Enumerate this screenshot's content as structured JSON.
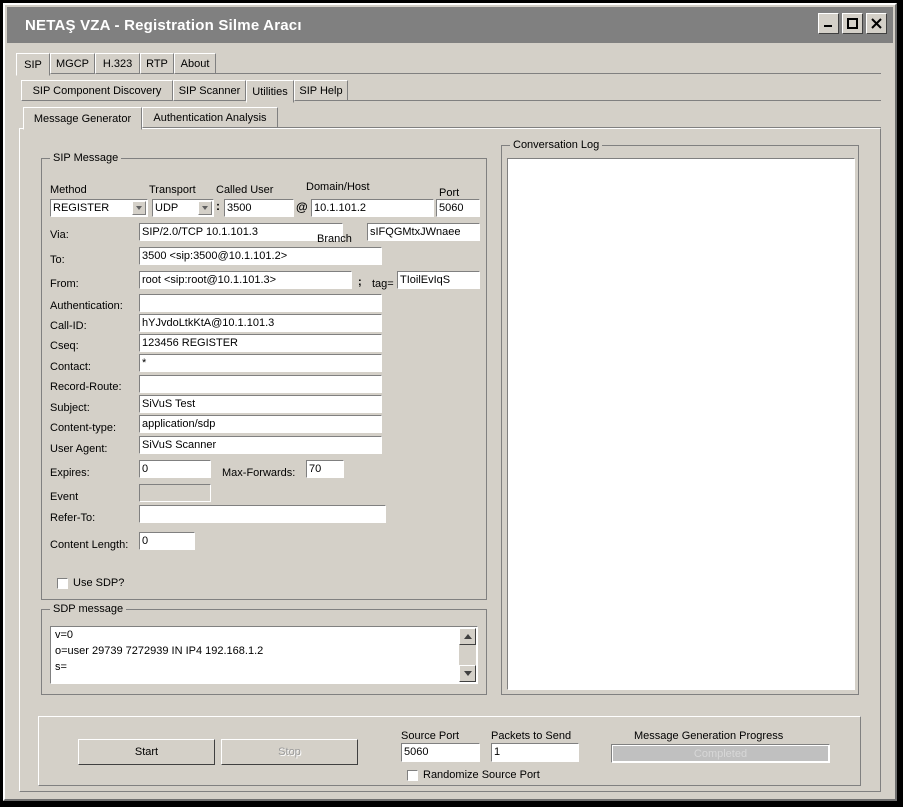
{
  "window": {
    "title": "NETAŞ VZA - Registration Silme Aracı",
    "minimize_label": "minimize",
    "maximize_label": "maximize",
    "close_label": "close"
  },
  "tabs_level1": [
    {
      "label": "SIP",
      "active": true
    },
    {
      "label": "MGCP",
      "active": false
    },
    {
      "label": "H.323",
      "active": false
    },
    {
      "label": "RTP",
      "active": false
    },
    {
      "label": "About",
      "active": false
    }
  ],
  "tabs_level2": [
    {
      "label": "SIP Component Discovery",
      "active": false
    },
    {
      "label": "SIP Scanner",
      "active": false
    },
    {
      "label": "Utilities",
      "active": true
    },
    {
      "label": "SIP Help",
      "active": false
    }
  ],
  "tabs_level3": [
    {
      "label": "Message Generator",
      "active": true
    },
    {
      "label": "Authentication Analysis",
      "active": false
    }
  ],
  "sip_message": {
    "group_label": "SIP Message",
    "method_label": "Method",
    "method_value": "REGISTER",
    "transport_label": "Transport",
    "transport_value": "UDP",
    "called_user_label": "Called User",
    "called_user_value": "3500",
    "domain_label": "Domain/Host",
    "domain_value": "10.1.101.2",
    "port_label": "Port",
    "port_value": "5060",
    "colon_symbol": ":",
    "at_symbol": "@",
    "via_label": "Via:",
    "via_value": "SIP/2.0/TCP 10.1.101.3",
    "branch_label": "Branch",
    "branch_value": "sIFQGMtxJWnaee",
    "to_label": "To:",
    "to_value": "3500 <sip:3500@10.1.101.2>",
    "from_label": "From:",
    "from_value": "root <sip:root@10.1.101.3>",
    "semicolon_symbol": ";",
    "tag_label": "tag=",
    "tag_value": "TIoilEvIqS",
    "authentication_label": "Authentication:",
    "authentication_value": "",
    "callid_label": "Call-ID:",
    "callid_value": "hYJvdoLtkKtA@10.1.101.3",
    "cseq_label": "Cseq:",
    "cseq_value": "123456 REGISTER",
    "contact_label": "Contact:",
    "contact_value": "*",
    "record_route_label": "Record-Route:",
    "record_route_value": "",
    "subject_label": "Subject:",
    "subject_value": "SiVuS Test",
    "content_type_label": "Content-type:",
    "content_type_value": "application/sdp",
    "user_agent_label": "User Agent:",
    "user_agent_value": "SiVuS Scanner",
    "expires_label": "Expires:",
    "expires_value": "0",
    "max_forwards_label": "Max-Forwards:",
    "max_forwards_value": "70",
    "event_label": "Event",
    "event_value": "",
    "refer_to_label": "Refer-To:",
    "refer_to_value": "",
    "content_length_label": "Content Length:",
    "content_length_value": "0",
    "use_sdp_label": "Use SDP?",
    "use_sdp_checked": false
  },
  "sdp": {
    "group_label": "SDP message",
    "lines": [
      "v=0",
      "o=user 29739 7272939 IN IP4 192.168.1.2",
      "s="
    ]
  },
  "conversation_log": {
    "group_label": "Conversation Log",
    "content": ""
  },
  "bottom": {
    "start_label": "Start",
    "stop_label": "Stop",
    "source_port_label": "Source Port",
    "source_port_value": "5060",
    "packets_label": "Packets to Send",
    "packets_value": "1",
    "randomize_label": "Randomize Source Port",
    "randomize_checked": false,
    "progress_label": "Message Generation Progress",
    "progress_status": "Completed",
    "progress_percent": 100
  },
  "colors": {
    "titlebar": "#808080",
    "face": "#d4d0c8",
    "field": "#ffffff",
    "border": "#808080",
    "progress_fill": "#c0c0c0"
  }
}
